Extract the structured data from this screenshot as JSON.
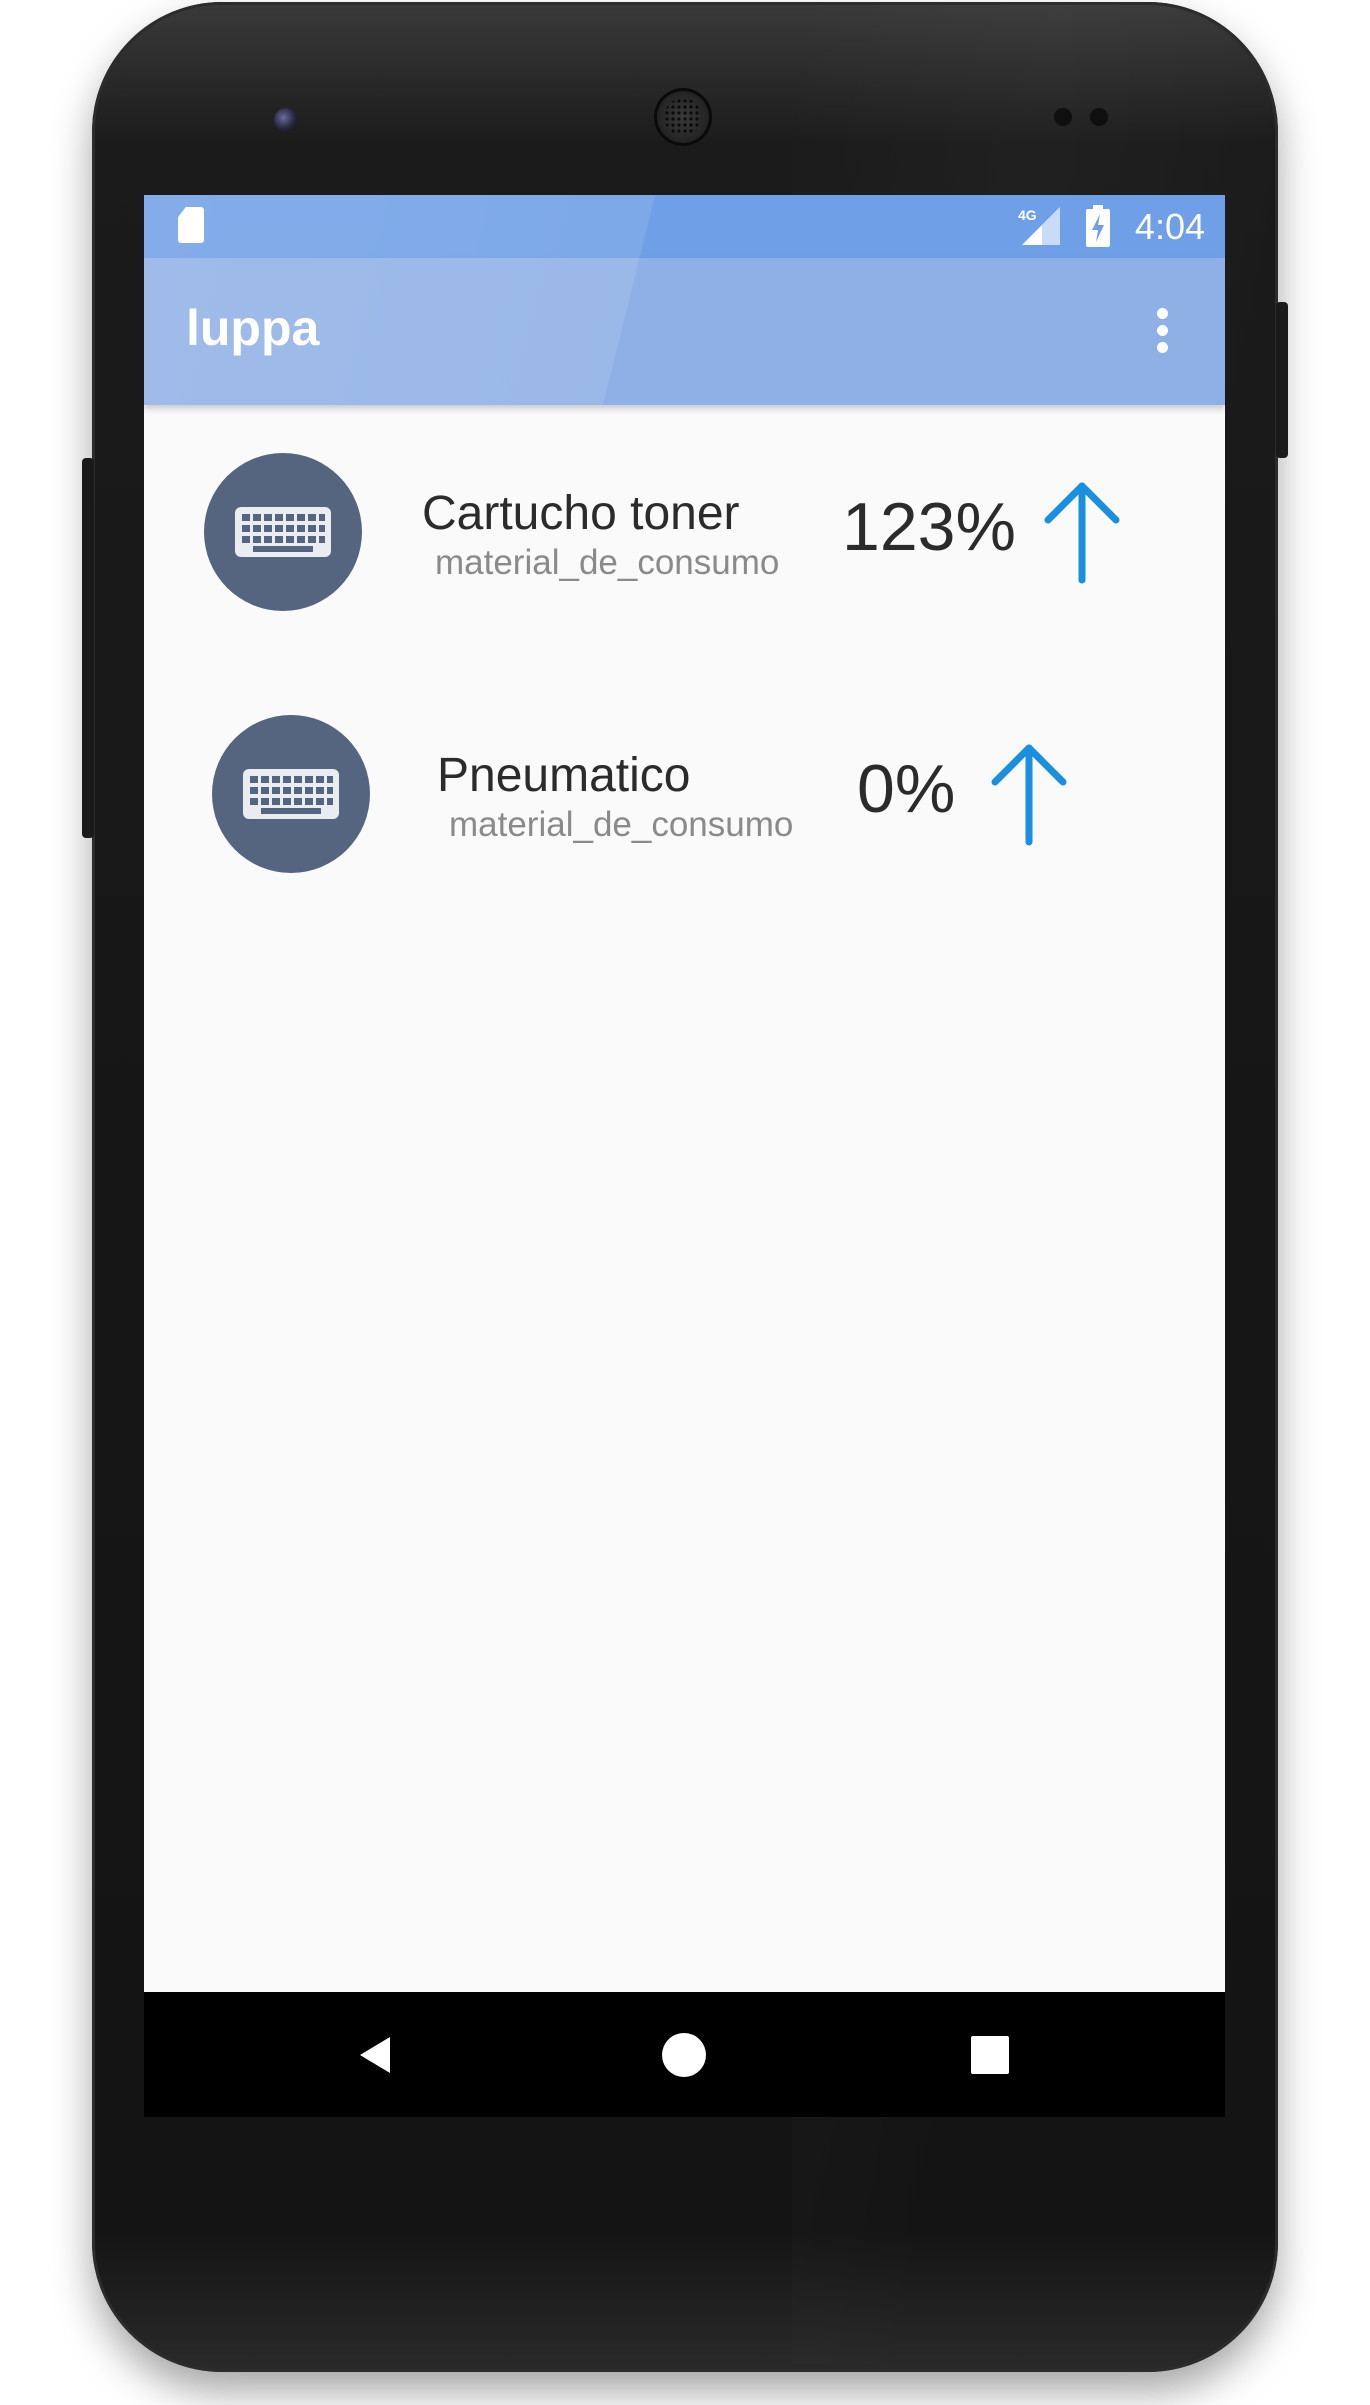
{
  "status_bar": {
    "time": "4:04",
    "network": "4G"
  },
  "app_bar": {
    "title": "luppa",
    "menu_icon": "more-vert-icon"
  },
  "items": [
    {
      "icon": "keyboard-icon",
      "title": "Cartucho toner",
      "subtitle": "material_de_consumo",
      "percent": "123%",
      "trend_icon": "arrow-up-icon"
    },
    {
      "icon": "keyboard-icon",
      "title": "Pneumatico",
      "subtitle": "material_de_consumo",
      "percent": "0%",
      "trend_icon": "arrow-up-icon"
    }
  ],
  "nav_bar": {
    "buttons": [
      "back-icon",
      "home-icon",
      "recents-icon"
    ]
  },
  "colors": {
    "status_bar": "#6f9fe6",
    "app_bar": "#8fb0e6",
    "avatar": "#55657f",
    "arrow": "#1a8fe0",
    "background": "#fafafa"
  }
}
